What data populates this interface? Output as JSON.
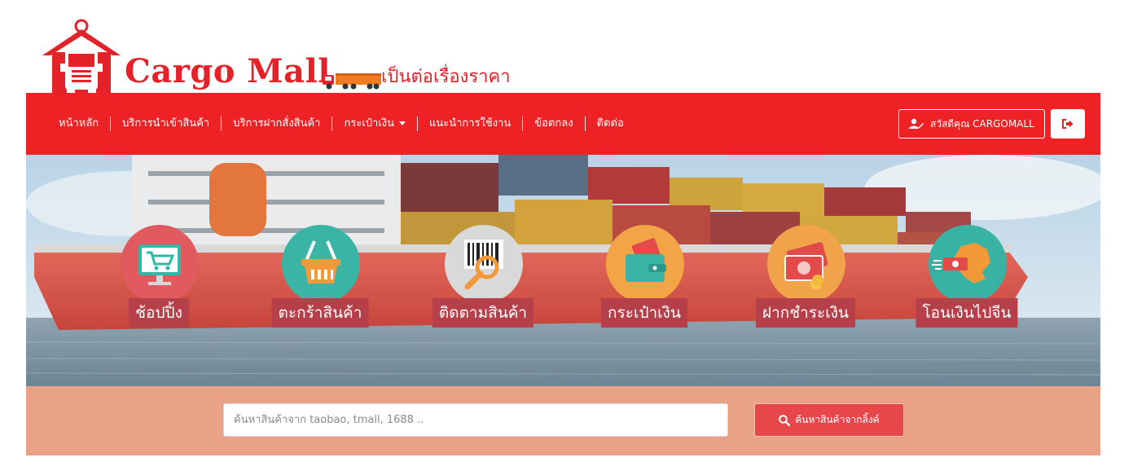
{
  "brand": {
    "name": "Cargo Mall",
    "tagline": "เป็นต่อเรื่องราคา",
    "color": "#e3222a",
    "logo_icon": "truck-house-logo",
    "tagline_icon": "truck-icon"
  },
  "navbar": {
    "background": "#ee2125",
    "items": [
      {
        "label": "หน้าหลัก"
      },
      {
        "label": "บริการนำเข้าสินค้า"
      },
      {
        "label": "บริการฝากสั่งสินค้า"
      },
      {
        "label": "กระเป๋าเงิน",
        "dropdown": true
      },
      {
        "label": "แนะนำการใช้งาน"
      },
      {
        "label": "ข้อตกลง"
      },
      {
        "label": "ติดต่อ"
      }
    ],
    "user_button": {
      "label": "สวัสดีคุณ CARGOMALL",
      "icon": "user-edit-icon"
    },
    "logout_button": {
      "icon": "sign-out-icon"
    }
  },
  "banner": {
    "services": [
      {
        "label": "ช้อปปิ้ง",
        "icon": "shopping-cart-monitor-icon",
        "color": "#e05a5f"
      },
      {
        "label": "ตะกร้าสินค้า",
        "icon": "basket-icon",
        "color": "#3ab4a5"
      },
      {
        "label": "ติดตามสินค้า",
        "icon": "barcode-search-icon",
        "color": "#d9d9d9"
      },
      {
        "label": "กระเป๋าเงิน",
        "icon": "wallet-icon",
        "color": "#f2a447"
      },
      {
        "label": "ฝากชำระเงิน",
        "icon": "money-payment-icon",
        "color": "#f0a34a"
      },
      {
        "label": "โอนเงินไปจีน",
        "icon": "china-transfer-icon",
        "color": "#37b2a3"
      }
    ]
  },
  "search": {
    "placeholder": "ค้นหาสินค้าจาก taobao, tmall, 1688 ..",
    "value": "",
    "button_label": "ค้นหาสินค้าจากลิ้งค์",
    "button_icon": "search-icon",
    "bar_color": "#e9a285",
    "button_color": "#e7474b"
  }
}
